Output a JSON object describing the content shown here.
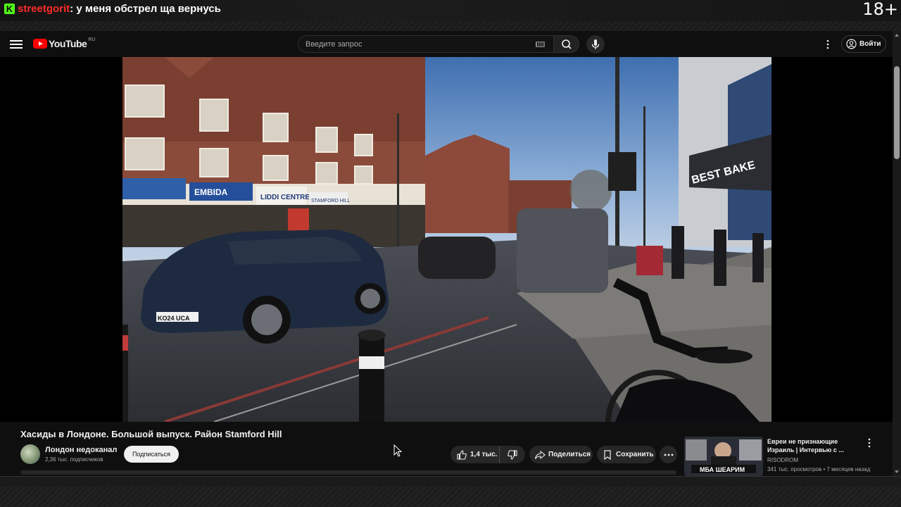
{
  "stream": {
    "platform_badge": "K",
    "chat_user": "streetgorit",
    "chat_message": ": у меня обстрел ща вернусь",
    "age_rating": "18+"
  },
  "header": {
    "logo_text": "YouTube",
    "logo_region": "RU",
    "search_placeholder": "Введите запрос",
    "signin_label": "Войти"
  },
  "video": {
    "title": "Хасиды в Лондоне. Большой выпуск. Район Stamford Hill",
    "channel": "Лондон недоканал",
    "subscribers": "2,36 тыс. подписчиков",
    "subscribe_label": "Подписаться",
    "likes": "1,4 тыс.",
    "share_label": "Поделиться",
    "save_label": "Сохранить",
    "scene": {
      "car_plate_front": "KO24 UCA",
      "shop_sign_1": "LIDDI CENTRE",
      "shop_sign_2": "STAMFORD HILL",
      "shop_sign_3": "EMBIDA",
      "big_sign": "BEST BAKE"
    }
  },
  "recommended": [
    {
      "title": "Евреи не признающие Израиль | Интервью с ...",
      "channel": "RISODROM",
      "meta": "341 тыс. просмотров • 7 месяцев назад",
      "thumb_caption": "МБА ШЕАРИМ"
    }
  ],
  "colors": {
    "kick_green": "#53fc18",
    "chat_user_red": "#ff2a2a",
    "youtube_red": "#ff0000",
    "background": "#0f0f0f"
  }
}
